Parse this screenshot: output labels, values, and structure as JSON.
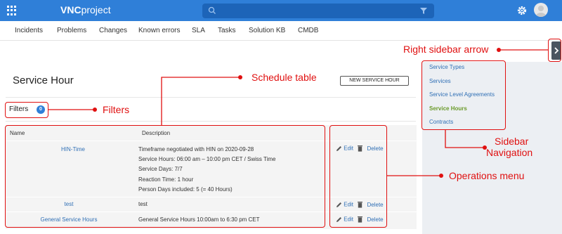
{
  "app": {
    "logo_bold": "VNC",
    "logo_rest": "project"
  },
  "nav": {
    "items": [
      "Incidents",
      "Problems",
      "Changes",
      "Known errors",
      "SLA",
      "Tasks",
      "Solution KB",
      "CMDB"
    ]
  },
  "page": {
    "title": "Service Hour",
    "new_button": "NEW SERVICE HOUR",
    "filters_label": "Filters",
    "filters_count": "0"
  },
  "table": {
    "headers": {
      "name": "Name",
      "description": "Description"
    },
    "rows": [
      {
        "name": "HIN-Time",
        "description": [
          "Timeframe negotiated with HIN on 2020-09-28",
          "Service Hours: 06:00 am – 10:00 pm CET / Swiss Time",
          "Service Days: 7/7",
          "Reaction Time: 1 hour",
          "Person Days included: 5 (= 40 Hours)"
        ]
      },
      {
        "name": "test",
        "description": [
          "test"
        ]
      },
      {
        "name": "General Service Hours",
        "description": [
          "General Service Hours 10:00am to 6:30 pm CET"
        ]
      }
    ],
    "ops": {
      "edit": "Edit",
      "delete": "Delete"
    }
  },
  "sidebar": {
    "items": [
      "Service Types",
      "Services",
      "Service Level Agreements",
      "Service Hours",
      "Contracts"
    ],
    "active": "Service Hours"
  },
  "annotations": {
    "schedule_table": "Schedule table",
    "filters": "Filters",
    "right_sidebar_arrow": "Right sidebar arrow",
    "sidebar_navigation_1": "Sidebar",
    "sidebar_navigation_2": "Navigation",
    "operations_menu": "Operations menu"
  },
  "colors": {
    "topbar": "#2f7fd8",
    "annotation": "#e01010",
    "link": "#2f6fb5",
    "active": "#6a9a2a"
  }
}
